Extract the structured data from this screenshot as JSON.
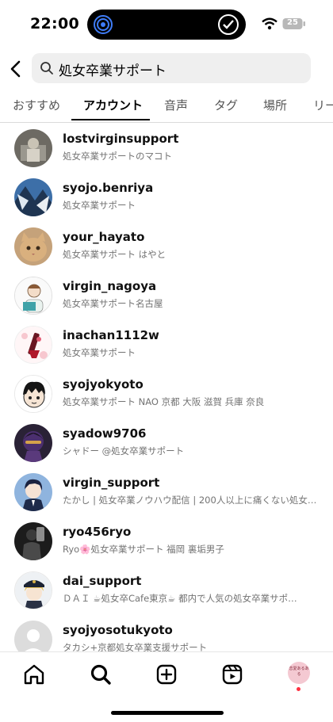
{
  "status_bar": {
    "time": "22:00",
    "battery": "25"
  },
  "search": {
    "query": "処女卒業サポート"
  },
  "tabs": [
    "おすすめ",
    "アカウント",
    "音声",
    "タグ",
    "場所",
    "リー"
  ],
  "active_tab": "アカウント",
  "accounts": [
    {
      "username": "lostvirginsupport",
      "subtitle": "処女卒業サポートのマコト"
    },
    {
      "username": "syojo.benriya",
      "subtitle": "処女卒業サポート"
    },
    {
      "username": "your_hayato",
      "subtitle": "処女卒業サポート はやと"
    },
    {
      "username": "virgin_nagoya",
      "subtitle": "処女卒業サポート名古屋"
    },
    {
      "username": "inachan1112w",
      "subtitle": "処女卒業サポート"
    },
    {
      "username": "syojyokyoto",
      "subtitle": "処女卒業サポート NAO 京都 大阪 滋賀 兵庫 奈良"
    },
    {
      "username": "syadow9706",
      "subtitle": "シャドー @処女卒業サポート"
    },
    {
      "username": "virgin_support",
      "subtitle": "たかし | 処女卒業ノウハウ配信 | 200人以上に痛くない処女…"
    },
    {
      "username": "ryo456ryo",
      "subtitle": "Ryo🌸処女卒業サポート 福岡 裏垢男子"
    },
    {
      "username": "dai_support",
      "subtitle": "ＤＡＩ ☕処女卒Cafe東京☕ 都内で人気の処女卒業サポ…"
    },
    {
      "username": "syojyosotukyoto",
      "subtitle": "タカシ+京都処女卒業支援サポート"
    }
  ],
  "profile_badge": "恋愛あるある",
  "icons": {
    "back": "back-arrow-icon",
    "search": "search-icon",
    "home": "home-icon",
    "explore": "search-icon",
    "create": "create-icon",
    "reels": "reels-icon",
    "wifi": "wifi-icon",
    "battery": "battery-icon"
  }
}
